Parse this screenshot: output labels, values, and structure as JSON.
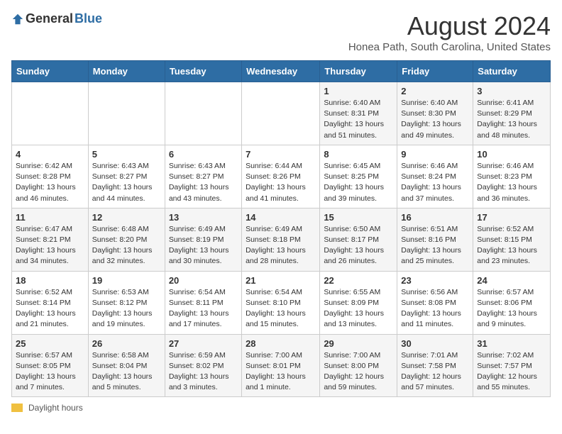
{
  "logo": {
    "general": "General",
    "blue": "Blue"
  },
  "header": {
    "title": "August 2024",
    "subtitle": "Honea Path, South Carolina, United States"
  },
  "weekdays": [
    "Sunday",
    "Monday",
    "Tuesday",
    "Wednesday",
    "Thursday",
    "Friday",
    "Saturday"
  ],
  "weeks": [
    [
      {
        "day": "",
        "info": ""
      },
      {
        "day": "",
        "info": ""
      },
      {
        "day": "",
        "info": ""
      },
      {
        "day": "",
        "info": ""
      },
      {
        "day": "1",
        "info": "Sunrise: 6:40 AM\nSunset: 8:31 PM\nDaylight: 13 hours and 51 minutes."
      },
      {
        "day": "2",
        "info": "Sunrise: 6:40 AM\nSunset: 8:30 PM\nDaylight: 13 hours and 49 minutes."
      },
      {
        "day": "3",
        "info": "Sunrise: 6:41 AM\nSunset: 8:29 PM\nDaylight: 13 hours and 48 minutes."
      }
    ],
    [
      {
        "day": "4",
        "info": "Sunrise: 6:42 AM\nSunset: 8:28 PM\nDaylight: 13 hours and 46 minutes."
      },
      {
        "day": "5",
        "info": "Sunrise: 6:43 AM\nSunset: 8:27 PM\nDaylight: 13 hours and 44 minutes."
      },
      {
        "day": "6",
        "info": "Sunrise: 6:43 AM\nSunset: 8:27 PM\nDaylight: 13 hours and 43 minutes."
      },
      {
        "day": "7",
        "info": "Sunrise: 6:44 AM\nSunset: 8:26 PM\nDaylight: 13 hours and 41 minutes."
      },
      {
        "day": "8",
        "info": "Sunrise: 6:45 AM\nSunset: 8:25 PM\nDaylight: 13 hours and 39 minutes."
      },
      {
        "day": "9",
        "info": "Sunrise: 6:46 AM\nSunset: 8:24 PM\nDaylight: 13 hours and 37 minutes."
      },
      {
        "day": "10",
        "info": "Sunrise: 6:46 AM\nSunset: 8:23 PM\nDaylight: 13 hours and 36 minutes."
      }
    ],
    [
      {
        "day": "11",
        "info": "Sunrise: 6:47 AM\nSunset: 8:21 PM\nDaylight: 13 hours and 34 minutes."
      },
      {
        "day": "12",
        "info": "Sunrise: 6:48 AM\nSunset: 8:20 PM\nDaylight: 13 hours and 32 minutes."
      },
      {
        "day": "13",
        "info": "Sunrise: 6:49 AM\nSunset: 8:19 PM\nDaylight: 13 hours and 30 minutes."
      },
      {
        "day": "14",
        "info": "Sunrise: 6:49 AM\nSunset: 8:18 PM\nDaylight: 13 hours and 28 minutes."
      },
      {
        "day": "15",
        "info": "Sunrise: 6:50 AM\nSunset: 8:17 PM\nDaylight: 13 hours and 26 minutes."
      },
      {
        "day": "16",
        "info": "Sunrise: 6:51 AM\nSunset: 8:16 PM\nDaylight: 13 hours and 25 minutes."
      },
      {
        "day": "17",
        "info": "Sunrise: 6:52 AM\nSunset: 8:15 PM\nDaylight: 13 hours and 23 minutes."
      }
    ],
    [
      {
        "day": "18",
        "info": "Sunrise: 6:52 AM\nSunset: 8:14 PM\nDaylight: 13 hours and 21 minutes."
      },
      {
        "day": "19",
        "info": "Sunrise: 6:53 AM\nSunset: 8:12 PM\nDaylight: 13 hours and 19 minutes."
      },
      {
        "day": "20",
        "info": "Sunrise: 6:54 AM\nSunset: 8:11 PM\nDaylight: 13 hours and 17 minutes."
      },
      {
        "day": "21",
        "info": "Sunrise: 6:54 AM\nSunset: 8:10 PM\nDaylight: 13 hours and 15 minutes."
      },
      {
        "day": "22",
        "info": "Sunrise: 6:55 AM\nSunset: 8:09 PM\nDaylight: 13 hours and 13 minutes."
      },
      {
        "day": "23",
        "info": "Sunrise: 6:56 AM\nSunset: 8:08 PM\nDaylight: 13 hours and 11 minutes."
      },
      {
        "day": "24",
        "info": "Sunrise: 6:57 AM\nSunset: 8:06 PM\nDaylight: 13 hours and 9 minutes."
      }
    ],
    [
      {
        "day": "25",
        "info": "Sunrise: 6:57 AM\nSunset: 8:05 PM\nDaylight: 13 hours and 7 minutes."
      },
      {
        "day": "26",
        "info": "Sunrise: 6:58 AM\nSunset: 8:04 PM\nDaylight: 13 hours and 5 minutes."
      },
      {
        "day": "27",
        "info": "Sunrise: 6:59 AM\nSunset: 8:02 PM\nDaylight: 13 hours and 3 minutes."
      },
      {
        "day": "28",
        "info": "Sunrise: 7:00 AM\nSunset: 8:01 PM\nDaylight: 13 hours and 1 minute."
      },
      {
        "day": "29",
        "info": "Sunrise: 7:00 AM\nSunset: 8:00 PM\nDaylight: 12 hours and 59 minutes."
      },
      {
        "day": "30",
        "info": "Sunrise: 7:01 AM\nSunset: 7:58 PM\nDaylight: 12 hours and 57 minutes."
      },
      {
        "day": "31",
        "info": "Sunrise: 7:02 AM\nSunset: 7:57 PM\nDaylight: 12 hours and 55 minutes."
      }
    ]
  ],
  "footer": {
    "daylight_label": "Daylight hours"
  }
}
